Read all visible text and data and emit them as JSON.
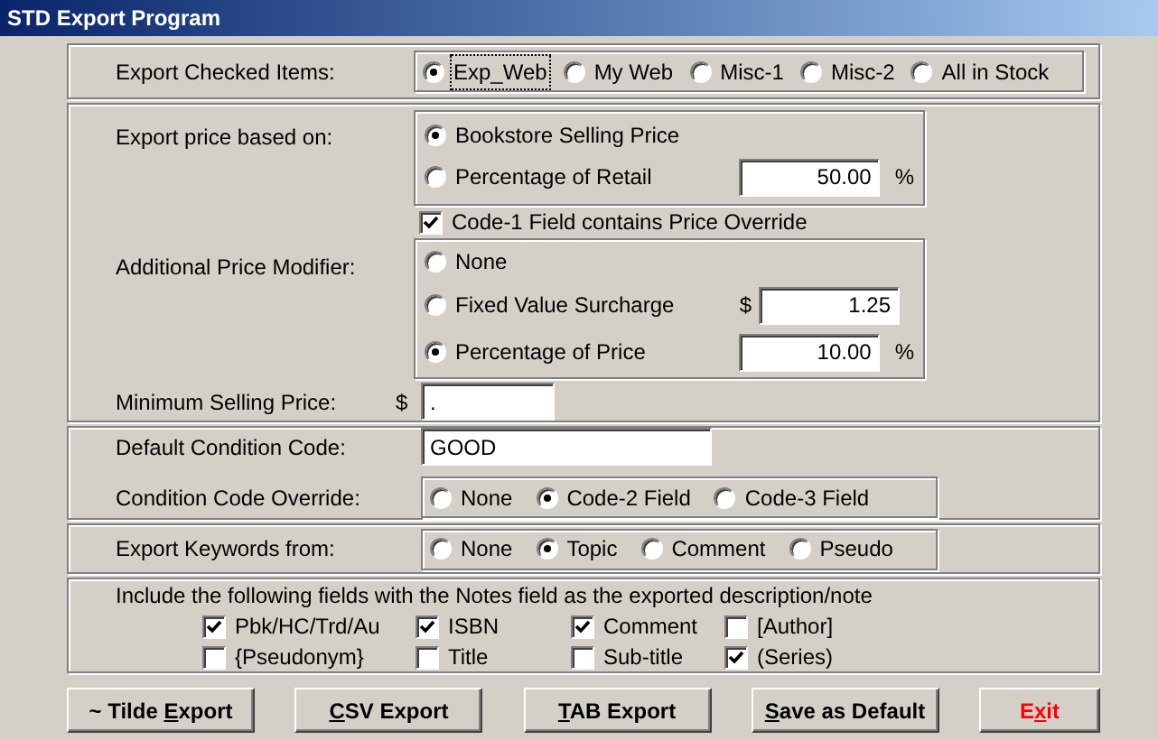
{
  "window": {
    "title": "STD Export Program"
  },
  "export_checked_items": {
    "label": "Export Checked Items:",
    "options": [
      {
        "label": "Exp_Web",
        "selected": true,
        "focused": true
      },
      {
        "label": "My Web",
        "selected": false,
        "focused": false
      },
      {
        "label": "Misc-1",
        "selected": false,
        "focused": false
      },
      {
        "label": "Misc-2",
        "selected": false,
        "focused": false
      },
      {
        "label": "All in Stock",
        "selected": false,
        "focused": false
      }
    ]
  },
  "price_basis": {
    "label": "Export price based on:",
    "options": [
      {
        "label": "Bookstore Selling Price",
        "selected": true
      },
      {
        "label": "Percentage of Retail",
        "selected": false,
        "value": "50.00",
        "unit": "%"
      }
    ]
  },
  "code1_override": {
    "label": "Code-1 Field contains Price Override",
    "checked": true
  },
  "price_modifier": {
    "label": "Additional Price Modifier:",
    "options": [
      {
        "label": "None",
        "selected": false
      },
      {
        "label": "Fixed Value Surcharge",
        "selected": false,
        "prefix": "$",
        "value": "1.25"
      },
      {
        "label": "Percentage of Price",
        "selected": true,
        "value": "10.00",
        "unit": "%"
      }
    ]
  },
  "minimum_price": {
    "label": "Minimum Selling Price:",
    "prefix": "$",
    "value": "."
  },
  "default_condition": {
    "label": "Default Condition Code:",
    "value": "GOOD"
  },
  "condition_override": {
    "label": "Condition Code Override:",
    "options": [
      {
        "label": "None",
        "selected": false
      },
      {
        "label": "Code-2 Field",
        "selected": true
      },
      {
        "label": "Code-3 Field",
        "selected": false
      }
    ]
  },
  "keywords": {
    "label": "Export Keywords from:",
    "options": [
      {
        "label": "None",
        "selected": false
      },
      {
        "label": "Topic",
        "selected": true
      },
      {
        "label": "Comment",
        "selected": false
      },
      {
        "label": "Pseudo",
        "selected": false
      }
    ]
  },
  "include_fields": {
    "label": "Include the following fields with the Notes field as the exported description/note",
    "fields": [
      {
        "label": "Pbk/HC/Trd/Au",
        "checked": true
      },
      {
        "label": "ISBN",
        "checked": true
      },
      {
        "label": "Comment",
        "checked": true
      },
      {
        "label": "[Author]",
        "checked": false
      },
      {
        "label": "{Pseudonym}",
        "checked": false
      },
      {
        "label": "Title",
        "checked": false
      },
      {
        "label": "Sub-title",
        "checked": false
      },
      {
        "label": "(Series)",
        "checked": true
      }
    ]
  },
  "buttons": [
    {
      "pre": "~ Tilde ",
      "key": "E",
      "post": "xport",
      "kind": "normal"
    },
    {
      "key": "C",
      "post": "SV Export",
      "kind": "normal"
    },
    {
      "key": "T",
      "post": "AB Export",
      "kind": "normal"
    },
    {
      "key": "S",
      "post": "ave as Default",
      "kind": "normal"
    },
    {
      "pre": "E",
      "key": "x",
      "post": "it",
      "kind": "exit"
    }
  ]
}
